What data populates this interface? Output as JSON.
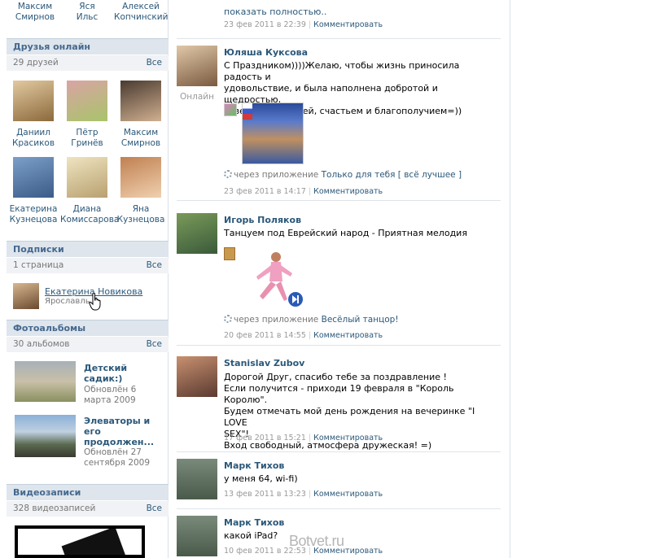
{
  "top_people": [
    {
      "first": "Максим",
      "last": "Смирнов"
    },
    {
      "first": "Яся",
      "last": "Ильс"
    },
    {
      "first": "Алексей",
      "last": "Копчинский"
    }
  ],
  "friends_online": {
    "title": "Друзья онлайн",
    "count": "29 друзей",
    "all": "Все",
    "people": [
      {
        "first": "Даниил",
        "last": "Красиков"
      },
      {
        "first": "Пётр",
        "last": "Гринёв"
      },
      {
        "first": "Максим",
        "last": "Смирнов"
      },
      {
        "first": "Екатерина",
        "last": "Кузнецова"
      },
      {
        "first": "Диана",
        "last": "Комиссарова"
      },
      {
        "first": "Яна",
        "last": "Кузнецова"
      }
    ]
  },
  "subscriptions": {
    "title": "Подписки",
    "count": "1 страница",
    "all": "Все",
    "item_name": "Екатерина Новикова",
    "item_city": "Ярославль"
  },
  "albums": {
    "title": "Фотоальбомы",
    "count": "30 альбомов",
    "all": "Все",
    "items": [
      {
        "title1": "Детский",
        "title2": "садик:)",
        "upd1": "Обновлён 6",
        "upd2": "марта 2009"
      },
      {
        "title1": "Элеваторы и",
        "title2": "его",
        "title3": "продолжен...",
        "upd1": "Обновлён 27",
        "upd2": "сентября 2009"
      }
    ]
  },
  "videos": {
    "title": "Видеозаписи",
    "count": "328 видеозаписей",
    "all": "Все"
  },
  "feed": {
    "top": {
      "more": "показать полностью..",
      "date": "23 фев 2011 в 22:39",
      "comment": "Комментировать"
    },
    "posts": [
      {
        "author": "Юляша Куксова",
        "online": "Онлайн",
        "lines": [
          "С Праздником))))Желаю, чтобы жизнь приносила радость и",
          "удовольствие, и была наполнена добротой и щедростью,",
          "везением и удачей, счастьем и благополучием=))"
        ],
        "via": "через приложение",
        "app": "Только для тебя [ всё лучшее ]",
        "date": "23 фев 2011 в 14:17",
        "comment": "Комментировать"
      },
      {
        "author": "Игорь Поляков",
        "lines": [
          "Танцуем под Еврейский народ - Приятная мелодия"
        ],
        "via": "через приложение",
        "app": "Весёлый танцор!",
        "date": "20 фев 2011 в 14:55",
        "comment": "Комментировать"
      },
      {
        "author": "Stanislav Zubov",
        "lines": [
          "Дорогой Друг, спасибо тебе за поздравление !",
          "Если получится - приходи 19 февраля в \"Король Королю\".",
          "Будем отмечать мой день рождения на вечеринке \"I LOVE",
          "SEX\"!",
          "Вход свободный, атмосфера дружеская! =)"
        ],
        "date": "17 фев 2011 в 15:21",
        "comment": "Комментировать"
      },
      {
        "author": "Марк Тихов",
        "lines": [
          "у меня 64, wi-fi)"
        ],
        "date": "13 фев 2011 в 13:23",
        "comment": "Комментировать"
      },
      {
        "author": "Марк Тихов",
        "lines": [
          "какой iPad?"
        ],
        "date": "10 фев 2011 в 22:53",
        "comment": "Комментировать"
      }
    ]
  },
  "watermark": "Botvet.ru",
  "colors": {
    "link": "#2b587a",
    "section_bg": "#dee5ec",
    "header_text": "#45688e"
  }
}
